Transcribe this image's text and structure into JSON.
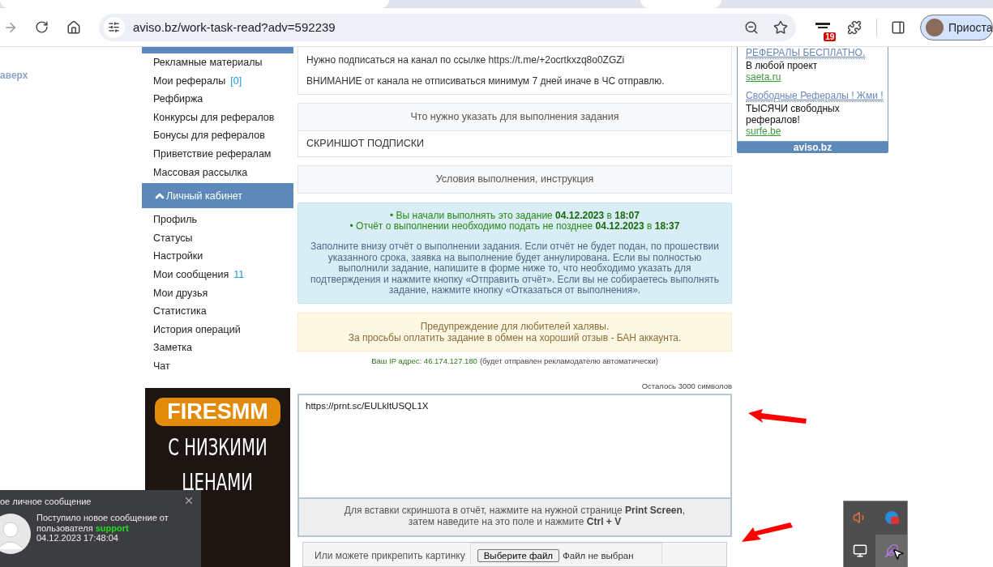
{
  "browser": {
    "url": "aviso.bz/work-task-read?adv=592239",
    "extension_badge": "19",
    "profile": "Приоста"
  },
  "left_column": {
    "back_to_top": "аверх"
  },
  "sidebar": {
    "items": [
      {
        "label": "Рекламные материалы"
      },
      {
        "label": "Мои рефералы",
        "count": "[0]"
      },
      {
        "label": "Рефбиржа"
      },
      {
        "label": "Конкурсы для рефералов"
      },
      {
        "label": "Бонусы для рефералов"
      },
      {
        "label": "Приветствие рефералам"
      },
      {
        "label": "Массовая рассылка"
      }
    ],
    "section": {
      "title": "Личный кабинет",
      "expanded": true,
      "items": [
        {
          "label": "Профиль"
        },
        {
          "label": "Статусы"
        },
        {
          "label": "Настройки"
        },
        {
          "label": "Мои сообщения",
          "count": "11"
        },
        {
          "label": "Мои друзья"
        },
        {
          "label": "Статистика"
        },
        {
          "label": "История операций"
        },
        {
          "label": "Заметка"
        },
        {
          "label": "Чат"
        }
      ]
    },
    "ad_banner": {
      "brand": "FIRESMM",
      "lines": [
        "С НИЗКИМИ",
        "ЦЕНАМИ"
      ]
    }
  },
  "task": {
    "lines": [
      "Нужно подписаться на канал по ссылке https://t.me/+2ocrtkxzq8o0ZGZi",
      "ВНИМАНИЕ от канала не отписиваться минимум 7 дней иначе в ЧС отправлю."
    ]
  },
  "required": {
    "header": "Что нужно указать для выполнения задания",
    "value": "СКРИНШОТ ПОДПИСКИ"
  },
  "conditions": {
    "header": "Условия выполнения, инструкция"
  },
  "info": {
    "status_lines": [
      "• Вы начали выполнять это задание **04.12.2023** в **18:07**",
      "• Отчёт о выполнении необходимо подать не позднее **04.12.2023** в **18:37**"
    ],
    "text": "Заполните внизу отчёт о выполнении задания. Если отчёт не будет подан, по прошествии указанного срока, заявка на выполнение будет аннулирована. Если вы полностью выполнили задание, напишите в форме ниже то, что необходимо указать для подтверждения и нажмите кнопку «Отправить отчёт». Если вы не собираетесь выполнять задание, нажмите кнопку «Отказаться от выполнения»."
  },
  "warning": {
    "lines": [
      "Предупреждение для любителей халявы.",
      "За просьбы оплатить задание в обмен на хороший отзыв - БАН аккаунта."
    ]
  },
  "ip": {
    "label": "Ваш IP адрес: 46.174.127.180",
    "note": "(будет отправлен рекламодателю автоматически)"
  },
  "report": {
    "remaining": "Осталось 3000 символов",
    "value": "https://prnt.sc/EULkltUSQL1X",
    "hint_lines": [
      "Для вставки скриншота в отчёт, нажмите на нужной странице **Print Screen**,",
      "затем наведите на это поле и нажмите **Ctrl + V**"
    ],
    "attach_label": "Или можете прикрепить картинку",
    "file_button": "Выберите файл",
    "file_status": "Файл не выбран"
  },
  "right_ads": {
    "items": [
      {
        "title": "РЕФЕРАЛЫ БЕСПЛАТНО.",
        "text": "В любой проект",
        "domain": "saeta.ru"
      },
      {
        "title": "Свободные Рефералы ! Жми !",
        "text": "ТЫСЯЧИ свободных рефералов!",
        "domain": "surfe.be"
      }
    ],
    "footer": "aviso.bz"
  },
  "notification": {
    "title": "ое личное сообщение",
    "body": "Поступило новое сообщение от пользователя **support**",
    "time": "04.12.2023 17:48:04"
  }
}
